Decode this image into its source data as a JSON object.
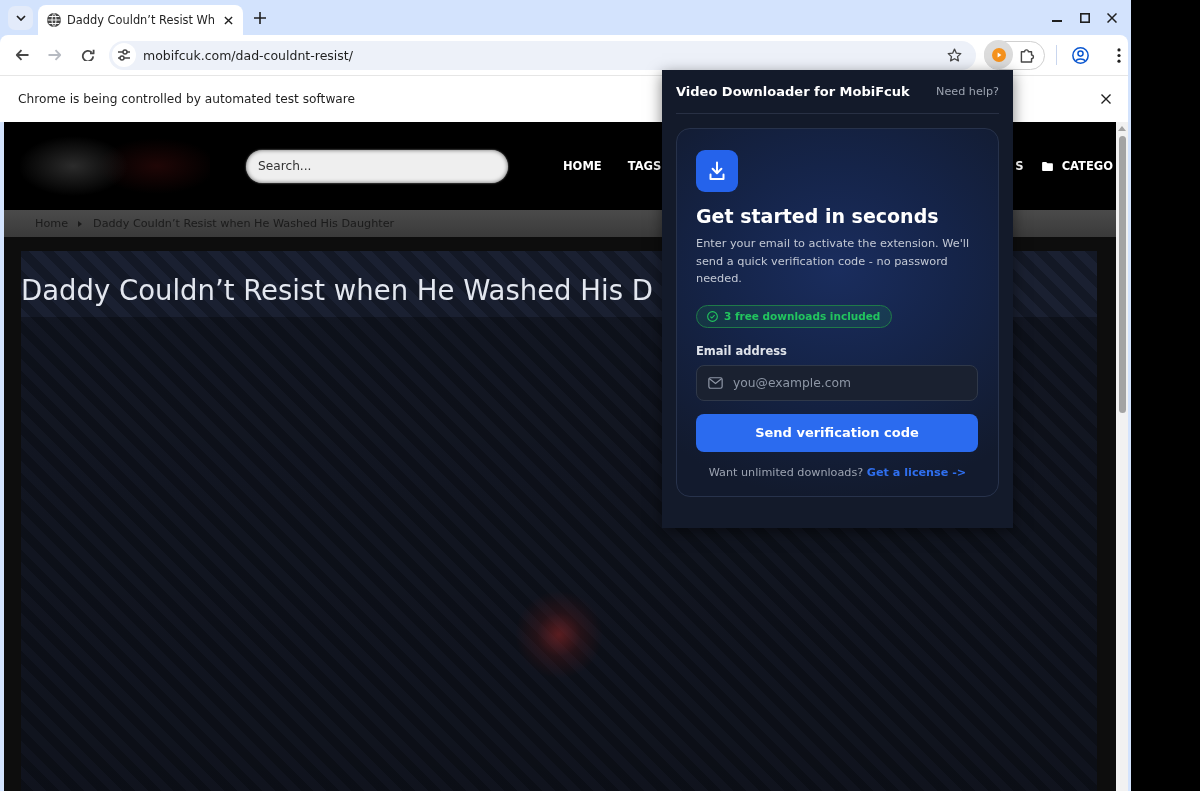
{
  "browser": {
    "tabs": [
      {
        "title": "Daddy Couldn’t Resist Wh",
        "selected": true
      }
    ],
    "nav_buttons": [
      {
        "kind": "back",
        "disabled": false
      },
      {
        "kind": "forward",
        "disabled": true
      },
      {
        "kind": "reload",
        "disabled": false
      }
    ],
    "address_bar": {
      "url": "mobifcuk.com/dad-couldnt-resist/"
    },
    "infobar": {
      "message": "Chrome is being controlled by automated test software"
    }
  },
  "site": {
    "search": {
      "placeholder": "Search..."
    },
    "nav": [
      {
        "label": "HOME",
        "kind": "text"
      },
      {
        "label": "TAGS",
        "kind": "text"
      },
      {
        "label": "S",
        "kind": "text"
      },
      {
        "label": "CATEGO",
        "kind": "folder"
      }
    ],
    "breadcrumb": [
      "Home",
      "Daddy Couldn’t Resist when He Washed His Daughter"
    ],
    "title": "Daddy Couldn’t Resist when He Washed His D"
  },
  "popup": {
    "title": "Video Downloader for MobiFcuk",
    "help_link": "Need help?",
    "heading": "Get started in seconds",
    "description": "Enter your email to activate the extension. We'll send a quick verification code - no password needed.",
    "badge": "3 free downloads included",
    "email": {
      "label": "Email address",
      "placeholder": "you@example.com"
    },
    "submit": "Send verification code",
    "footer": {
      "text": "Want unlimited downloads?",
      "link": "Get a license ->"
    }
  }
}
